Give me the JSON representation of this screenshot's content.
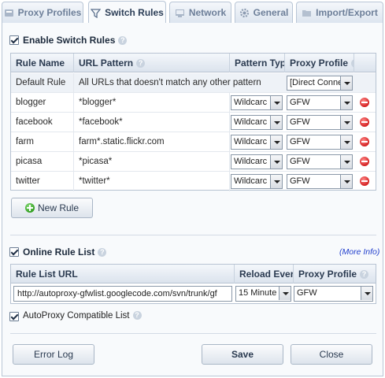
{
  "tabs": [
    {
      "label": "Proxy Profiles",
      "icon": "proxy-profiles-icon"
    },
    {
      "label": "Switch Rules",
      "icon": "filter-icon"
    },
    {
      "label": "Network",
      "icon": "network-icon"
    },
    {
      "label": "General",
      "icon": "gear-icon"
    },
    {
      "label": "Import/Export",
      "icon": "folder-icon"
    }
  ],
  "switch_rules": {
    "enable_label": "Enable Switch Rules",
    "enabled": true,
    "columns": [
      "Rule Name",
      "URL Pattern",
      "Pattern Typ",
      "Proxy Profile"
    ],
    "default_rule": {
      "name": "Default Rule",
      "pattern": "All URLs that doesn't match any other pattern",
      "profile": "[Direct Conne"
    },
    "rules": [
      {
        "name": "blogger",
        "pattern": "*blogger*",
        "type": "Wildcarc",
        "profile": "GFW"
      },
      {
        "name": "facebook",
        "pattern": "*facebook*",
        "type": "Wildcarc",
        "profile": "GFW"
      },
      {
        "name": "farm",
        "pattern": "farm*.static.flickr.com",
        "type": "Wildcarc",
        "profile": "GFW"
      },
      {
        "name": "picasa",
        "pattern": "*picasa*",
        "type": "Wildcarc",
        "profile": "GFW"
      },
      {
        "name": "twitter",
        "pattern": "*twitter*",
        "type": "Wildcarc",
        "profile": "GFW"
      }
    ],
    "new_rule_label": "New Rule"
  },
  "online_list": {
    "label": "Online Rule List",
    "enabled": true,
    "more_info": "(More Info)",
    "columns": [
      "Rule List URL",
      "Reload Every",
      "Proxy Profile"
    ],
    "url": "http://autoproxy-gfwlist.googlecode.com/svn/trunk/gf",
    "reload": "15 Minute",
    "profile": "GFW",
    "autoproxy_label": "AutoProxy Compatible List",
    "autoproxy_enabled": true
  },
  "buttons": {
    "error_log": "Error Log",
    "save": "Save",
    "close": "Close"
  },
  "colors": {
    "accent_tab_border": "#b9c6d6",
    "delete": "#d41f1f",
    "add": "#2f9d1f",
    "link": "#1e3ccc"
  }
}
